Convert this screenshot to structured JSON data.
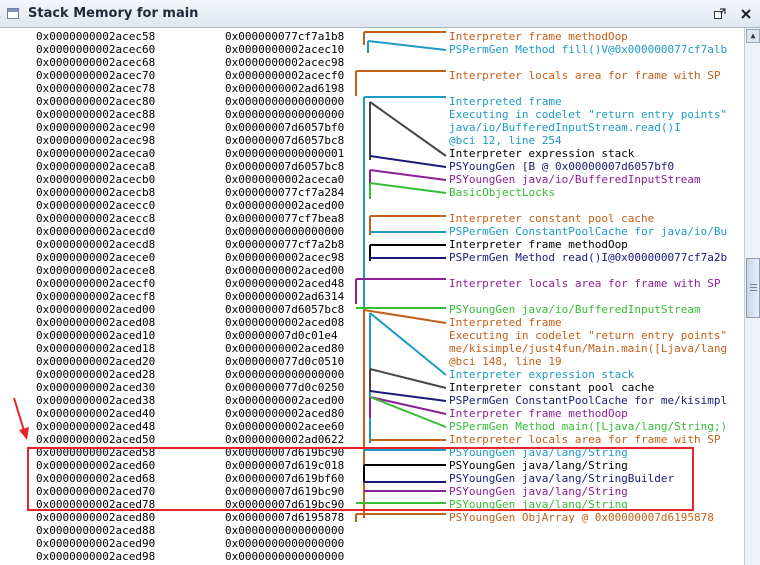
{
  "window": {
    "title": "Stack Memory for main"
  },
  "colors": {
    "orange": "#c2601a",
    "teal": "#1d9bc4",
    "darkgray": "#454545",
    "navy": "#1a1a78",
    "purple": "#8c2095",
    "green": "#35bd35",
    "black": "#000000",
    "highlight": "#e8242b"
  },
  "rows": [
    {
      "addr": "0x0000000002acec58",
      "val": "0x000000077cf7a1b8"
    },
    {
      "addr": "0x0000000002acec60",
      "val": "0x0000000002acec10"
    },
    {
      "addr": "0x0000000002acec68",
      "val": "0x0000000002acec98"
    },
    {
      "addr": "0x0000000002acec70",
      "val": "0x0000000002acecf0"
    },
    {
      "addr": "0x0000000002acec78",
      "val": "0x0000000002ad6198"
    },
    {
      "addr": "0x0000000002acec80",
      "val": "0x0000000000000000"
    },
    {
      "addr": "0x0000000002acec88",
      "val": "0x0000000000000000"
    },
    {
      "addr": "0x0000000002acec90",
      "val": "0x00000007d6057bf0"
    },
    {
      "addr": "0x0000000002acec98",
      "val": "0x00000007d6057bc8"
    },
    {
      "addr": "0x0000000002aceca0",
      "val": "0x0000000000000001"
    },
    {
      "addr": "0x0000000002aceca8",
      "val": "0x00000007d6057bc8"
    },
    {
      "addr": "0x0000000002acecb0",
      "val": "0x0000000002aceca0"
    },
    {
      "addr": "0x0000000002acecb8",
      "val": "0x000000077cf7a284"
    },
    {
      "addr": "0x0000000002acecc0",
      "val": "0x0000000002aced00"
    },
    {
      "addr": "0x0000000002acecc8",
      "val": "0x000000077cf7bea8"
    },
    {
      "addr": "0x0000000002acecd0",
      "val": "0x0000000000000000"
    },
    {
      "addr": "0x0000000002acecd8",
      "val": "0x000000077cf7a2b8"
    },
    {
      "addr": "0x0000000002acece0",
      "val": "0x0000000002acec98"
    },
    {
      "addr": "0x0000000002acece8",
      "val": "0x0000000002aced00"
    },
    {
      "addr": "0x0000000002acecf0",
      "val": "0x0000000002aced48"
    },
    {
      "addr": "0x0000000002acecf8",
      "val": "0x0000000002ad6314"
    },
    {
      "addr": "0x0000000002aced00",
      "val": "0x00000007d6057bc8"
    },
    {
      "addr": "0x0000000002aced08",
      "val": "0x0000000002aced08"
    },
    {
      "addr": "0x0000000002aced10",
      "val": "0x00000007d0c01e4"
    },
    {
      "addr": "0x0000000002aced18",
      "val": "0x0000000002aced80"
    },
    {
      "addr": "0x0000000002aced20",
      "val": "0x000000077d0c0510"
    },
    {
      "addr": "0x0000000002aced28",
      "val": "0x0000000000000000"
    },
    {
      "addr": "0x0000000002aced30",
      "val": "0x000000077d0c0250"
    },
    {
      "addr": "0x0000000002aced38",
      "val": "0x0000000002aced00"
    },
    {
      "addr": "0x0000000002aced40",
      "val": "0x0000000002aced80"
    },
    {
      "addr": "0x0000000002aced48",
      "val": "0x0000000002acee60"
    },
    {
      "addr": "0x0000000002aced50",
      "val": "0x0000000002ad0622"
    },
    {
      "addr": "0x0000000002aced58",
      "val": "0x00000007d619bc90"
    },
    {
      "addr": "0x0000000002aced60",
      "val": "0x00000007d619c018"
    },
    {
      "addr": "0x0000000002aced68",
      "val": "0x00000007d619bf60"
    },
    {
      "addr": "0x0000000002aced70",
      "val": "0x00000007d619bc90"
    },
    {
      "addr": "0x0000000002aced78",
      "val": "0x00000007d619bc90"
    },
    {
      "addr": "0x0000000002aced80",
      "val": "0x00000007d6195878"
    },
    {
      "addr": "0x0000000002aced88",
      "val": "0x0000000000000000"
    },
    {
      "addr": "0x0000000002aced90",
      "val": "0x0000000000000000"
    },
    {
      "addr": "0x0000000002aced98",
      "val": "0x0000000000000000"
    }
  ],
  "annotations": [
    {
      "text": "Interpreter frame methodOop",
      "color": "orange"
    },
    {
      "text": "PSPermGen Method fill()V@0x000000077cf7alb",
      "color": "teal"
    },
    {
      "text": "",
      "color": "black"
    },
    {
      "text": "Interpreter locals area for frame with SP",
      "color": "orange"
    },
    {
      "text": "",
      "color": "black"
    },
    {
      "text": "Interpreted frame",
      "color": "teal"
    },
    {
      "text": "Executing in codelet \"return entry points\"",
      "color": "teal"
    },
    {
      "text": "java/io/BufferedInputStream.read()I",
      "color": "teal"
    },
    {
      "text": "@bci 12, line 254",
      "color": "teal"
    },
    {
      "text": "Interpreter expression stack",
      "color": "black"
    },
    {
      "text": "PSYoungGen [B @ 0x00000007d6057bf0",
      "color": "navy"
    },
    {
      "text": "PSYoungGen java/io/BufferedInputStream",
      "color": "purple"
    },
    {
      "text": "BasicObjectLocks",
      "color": "green"
    },
    {
      "text": "",
      "color": "black"
    },
    {
      "text": "Interpreter constant pool cache",
      "color": "orange"
    },
    {
      "text": "PSPermGen ConstantPoolCache for java/io/Bu",
      "color": "teal"
    },
    {
      "text": "Interpreter frame methodOop",
      "color": "black"
    },
    {
      "text": "PSPermGen Method read()I@0x000000077cf7a2b",
      "color": "navy"
    },
    {
      "text": "",
      "color": "black"
    },
    {
      "text": "Interpreter locals area for frame with SP",
      "color": "purple"
    },
    {
      "text": "",
      "color": "black"
    },
    {
      "text": "PSYoungGen java/io/BufferedInputStream",
      "color": "green"
    },
    {
      "text": "Interpreted frame",
      "color": "orange"
    },
    {
      "text": "Executing in codelet \"return entry points\"",
      "color": "orange"
    },
    {
      "text": "me/kisimple/just4fun/Main.main([Ljava/lang",
      "color": "orange"
    },
    {
      "text": "@bci 148, line 19",
      "color": "orange"
    },
    {
      "text": "Interpreter expression stack",
      "color": "teal"
    },
    {
      "text": "Interpreter constant pool cache",
      "color": "black"
    },
    {
      "text": "PSPermGen ConstantPoolCache for me/kisimpl",
      "color": "navy"
    },
    {
      "text": "Interpreter frame methodOop",
      "color": "purple"
    },
    {
      "text": "PSPermGen Method main([Ljava/lang/String;)",
      "color": "green"
    },
    {
      "text": "Interpreter locals area for frame with SP",
      "color": "orange"
    },
    {
      "text": "PSYoungGen java/lang/String",
      "color": "teal"
    },
    {
      "text": "PSYoungGen java/lang/String",
      "color": "black"
    },
    {
      "text": "PSYoungGen java/lang/StringBuilder",
      "color": "navy"
    },
    {
      "text": "PSYoungGen java/lang/String",
      "color": "purple"
    },
    {
      "text": "PSYoungGen java/lang/String",
      "color": "green"
    },
    {
      "text": "PSYoungGen ObjArray @ 0x00000007d6195878",
      "color": "orange"
    },
    {
      "text": "",
      "color": "black"
    },
    {
      "text": "",
      "color": "black"
    },
    {
      "text": "",
      "color": "black"
    }
  ]
}
